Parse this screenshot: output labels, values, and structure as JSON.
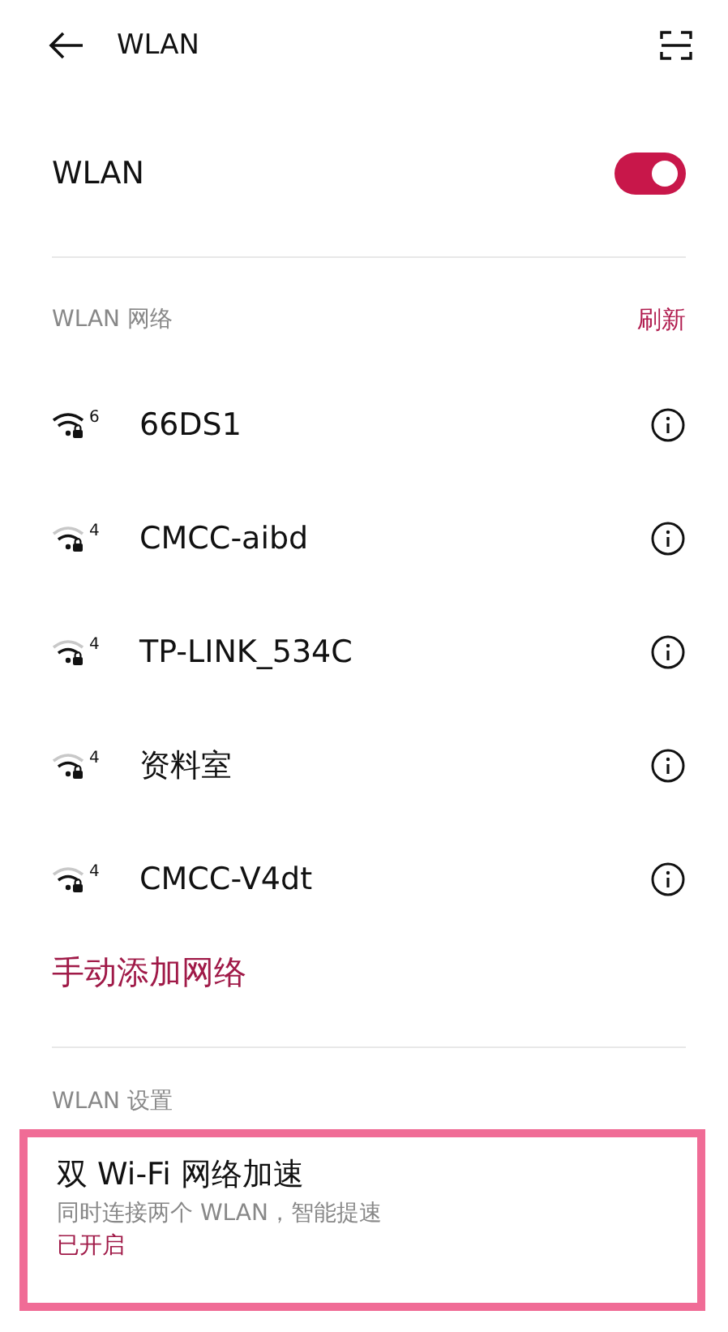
{
  "header": {
    "title": "WLAN"
  },
  "wlan_toggle": {
    "label": "WLAN",
    "on": true
  },
  "networks_section": {
    "title": "WLAN 网络",
    "action": "刷新"
  },
  "networks": [
    {
      "name": "66DS1",
      "standard": "6",
      "kind": "strong"
    },
    {
      "name": "CMCC-aibd",
      "standard": "4",
      "kind": "weak"
    },
    {
      "name": "TP-LINK_534C",
      "standard": "4",
      "kind": "weak"
    },
    {
      "name": "资料室",
      "standard": "4",
      "kind": "weak"
    },
    {
      "name": "CMCC-V4dt",
      "standard": "4",
      "kind": "weak"
    }
  ],
  "add_network": "手动添加网络",
  "settings_section": {
    "title": "WLAN 设置"
  },
  "dual_wifi": {
    "title": "双 Wi-Fi 网络加速",
    "description": "同时连接两个 WLAN，智能提速",
    "status": "已开启",
    "highlighted": true
  }
}
